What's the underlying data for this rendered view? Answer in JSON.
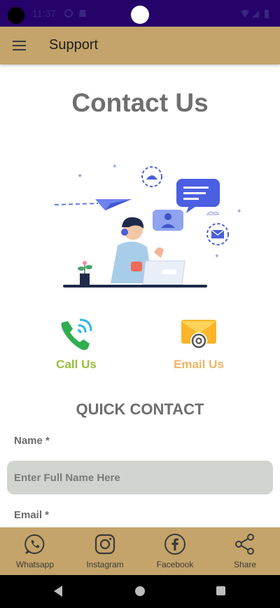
{
  "status_bar": {
    "time": "11:37"
  },
  "app_bar": {
    "title": "Support"
  },
  "page": {
    "heading": "Contact Us"
  },
  "contact_options": {
    "call": {
      "label": "Call Us"
    },
    "email": {
      "label": "Email Us"
    }
  },
  "quick_contact": {
    "title": "QUICK CONTACT",
    "name_label": "Name *",
    "name_placeholder": "Enter Full Name Here",
    "name_value": "",
    "email_label": "Email *"
  },
  "bottom_nav": {
    "items": [
      {
        "label": "Whatsapp",
        "icon": "whatsapp-icon"
      },
      {
        "label": "Instagram",
        "icon": "instagram-icon"
      },
      {
        "label": "Facebook",
        "icon": "facebook-icon"
      },
      {
        "label": "Share",
        "icon": "share-icon"
      }
    ]
  },
  "colors": {
    "status_bar": "#25036b",
    "app_bar": "#c4a46a",
    "call_green": "#98bd3a",
    "email_orange": "#f0b464",
    "input_bg": "#d1d4ce"
  }
}
